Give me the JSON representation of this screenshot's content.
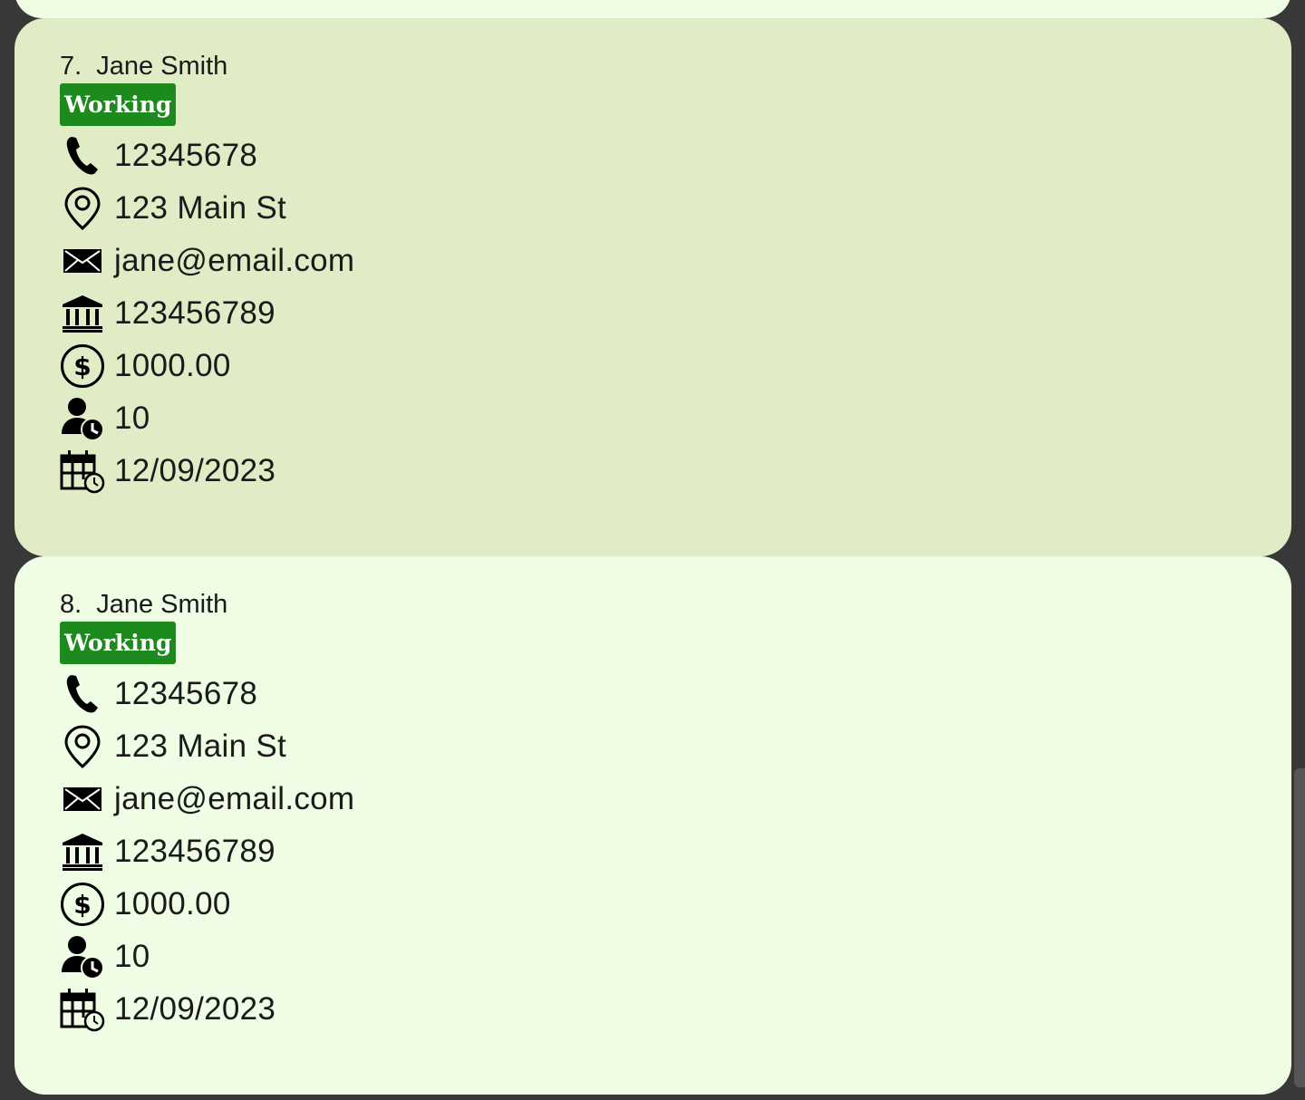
{
  "cards": [
    {
      "index": "7.",
      "name": "Jane Smith",
      "status": "Working",
      "phone": "12345678",
      "address": "123 Main St",
      "email": "jane@email.com",
      "bank_account": "123456789",
      "salary": "1000.00",
      "hours": "10",
      "date": "12/09/2023"
    },
    {
      "index": "8.",
      "name": "Jane Smith",
      "status": "Working",
      "phone": "12345678",
      "address": "123 Main St",
      "email": "jane@email.com",
      "bank_account": "123456789",
      "salary": "1000.00",
      "hours": "10",
      "date": "12/09/2023"
    }
  ],
  "colors": {
    "background": "#383838",
    "card_selected": "#e0ecc5",
    "card_default": "#f0fde5",
    "badge_working": "#1c8a1c"
  },
  "icons": [
    "phone-icon",
    "location-pin-icon",
    "envelope-icon",
    "bank-icon",
    "dollar-circle-icon",
    "user-clock-icon",
    "calendar-clock-icon"
  ]
}
